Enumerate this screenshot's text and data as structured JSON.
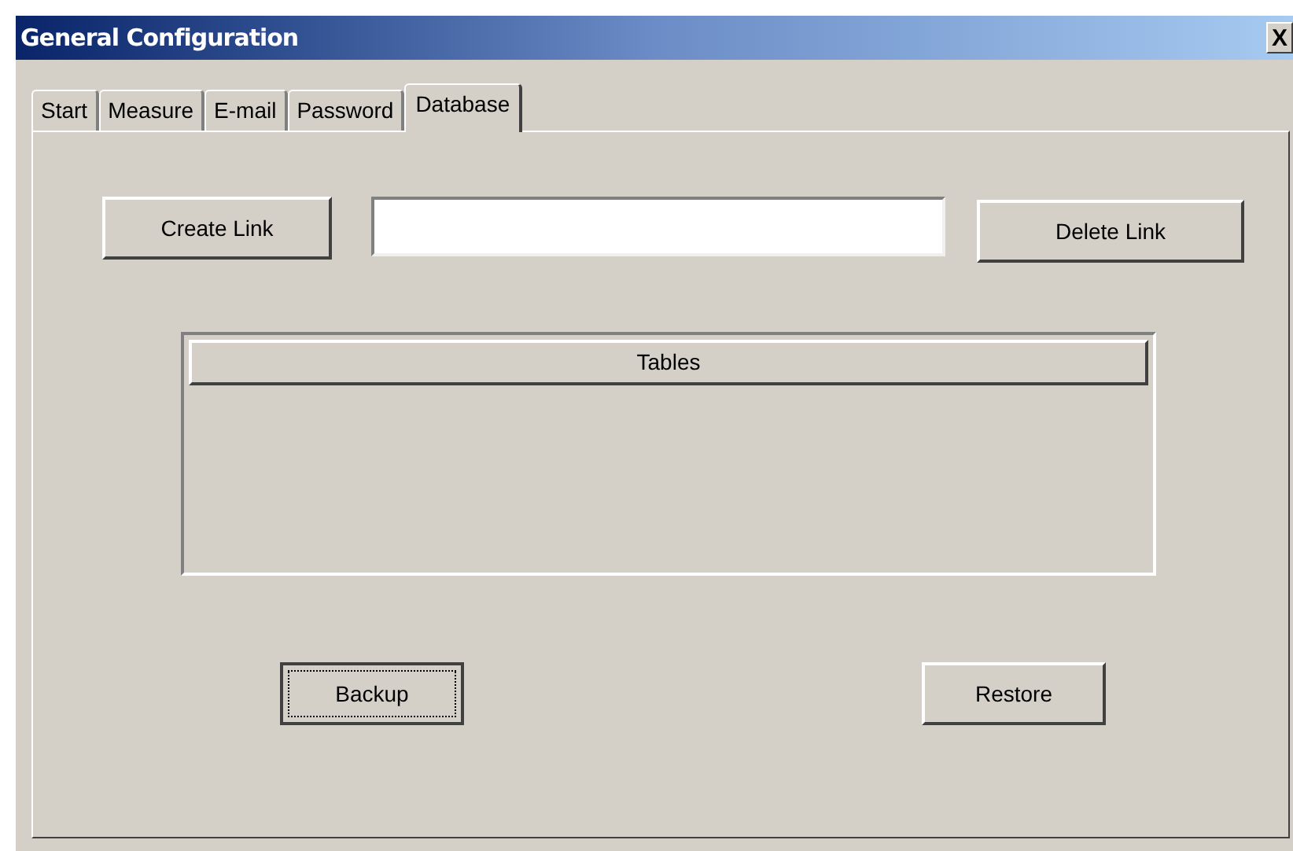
{
  "window": {
    "title": "General Configuration",
    "close_label": "X"
  },
  "tabs": [
    {
      "label": "Start",
      "selected": false
    },
    {
      "label": "Measure",
      "selected": false
    },
    {
      "label": "E-mail",
      "selected": false
    },
    {
      "label": "Password",
      "selected": false
    },
    {
      "label": "Database",
      "selected": true
    }
  ],
  "link_row": {
    "create_button": "Create Link",
    "delete_button": "Delete Link"
  },
  "table": {
    "columns": [
      "Tables"
    ]
  },
  "buttons": [
    {
      "label": "Backup",
      "focused": true
    },
    {
      "label": "Restore",
      "focused": false
    }
  ]
}
